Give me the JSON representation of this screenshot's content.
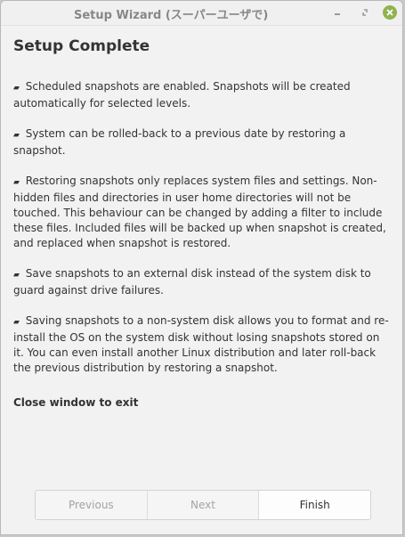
{
  "window": {
    "title": "Setup Wizard (スーパーユーザで)"
  },
  "content": {
    "heading": "Setup Complete",
    "bullet_glyph": "▰",
    "paragraphs": [
      "Scheduled snapshots are enabled. Snapshots will be created automatically for selected levels.",
      "System can be rolled-back to a previous date by restoring a snapshot.",
      "Restoring snapshots only replaces system files and settings. Non-hidden files and directories in user home directories will not be touched. This behaviour can be changed by adding a filter to include these files. Included files will be backed up when snapshot is created, and replaced when snapshot is restored.",
      "Save snapshots to an external disk instead of the system disk to guard against drive failures.",
      "Saving snapshots to a non-system disk allows you to format and re-install the OS on the system disk without losing snapshots stored on it. You can even install another Linux distribution and later roll-back the previous distribution by restoring a snapshot."
    ],
    "exit_note": "Close window to exit"
  },
  "buttons": {
    "previous": "Previous",
    "next": "Next",
    "finish": "Finish"
  },
  "colors": {
    "close_button": "#8fb34f"
  }
}
